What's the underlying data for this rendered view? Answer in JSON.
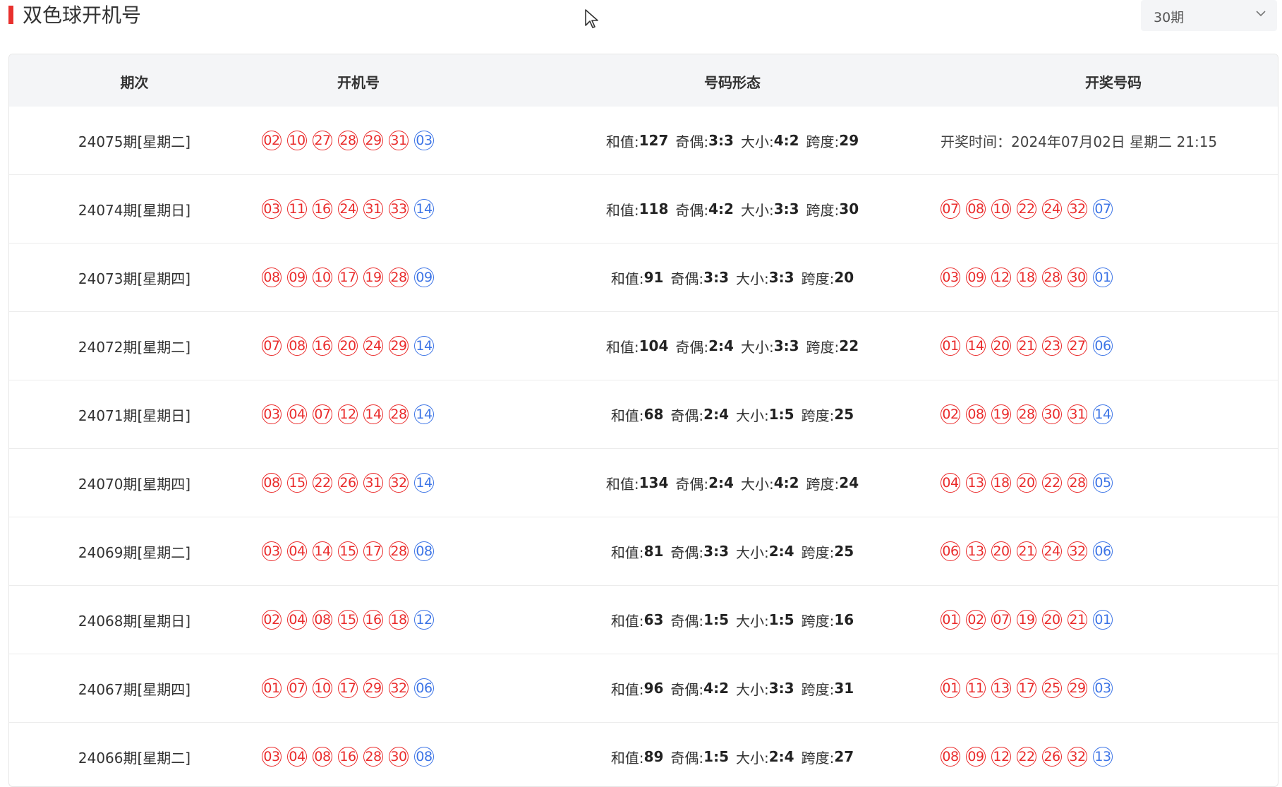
{
  "page": {
    "title": "双色球开机号"
  },
  "period_select": {
    "value": "30期"
  },
  "colors": {
    "red_ball": "#ea2b2b",
    "blue_ball": "#3c74e6",
    "accent": "#e8302d"
  },
  "table": {
    "headers": [
      "期次",
      "开机号",
      "号码形态",
      "开奖号码"
    ],
    "shape_labels": {
      "sum": "和值:",
      "odd_even": "奇偶:",
      "big_small": "大小:",
      "span": "跨度:"
    },
    "rows": [
      {
        "issue": "24075期[星期二]",
        "machine_red": [
          "02",
          "10",
          "27",
          "28",
          "29",
          "31"
        ],
        "machine_blue": "03",
        "sum": "127",
        "odd_even": "3:3",
        "big_small": "4:2",
        "span": "29",
        "draw_time": "开奖时间：2024年07月02日 星期二 21:15",
        "win_red": [],
        "win_blue": ""
      },
      {
        "issue": "24074期[星期日]",
        "machine_red": [
          "03",
          "11",
          "16",
          "24",
          "31",
          "33"
        ],
        "machine_blue": "14",
        "sum": "118",
        "odd_even": "4:2",
        "big_small": "3:3",
        "span": "30",
        "draw_time": "",
        "win_red": [
          "07",
          "08",
          "10",
          "22",
          "24",
          "32"
        ],
        "win_blue": "07"
      },
      {
        "issue": "24073期[星期四]",
        "machine_red": [
          "08",
          "09",
          "10",
          "17",
          "19",
          "28"
        ],
        "machine_blue": "09",
        "sum": "91",
        "odd_even": "3:3",
        "big_small": "3:3",
        "span": "20",
        "draw_time": "",
        "win_red": [
          "03",
          "09",
          "12",
          "18",
          "28",
          "30"
        ],
        "win_blue": "01"
      },
      {
        "issue": "24072期[星期二]",
        "machine_red": [
          "07",
          "08",
          "16",
          "20",
          "24",
          "29"
        ],
        "machine_blue": "14",
        "sum": "104",
        "odd_even": "2:4",
        "big_small": "3:3",
        "span": "22",
        "draw_time": "",
        "win_red": [
          "01",
          "14",
          "20",
          "21",
          "23",
          "27"
        ],
        "win_blue": "06"
      },
      {
        "issue": "24071期[星期日]",
        "machine_red": [
          "03",
          "04",
          "07",
          "12",
          "14",
          "28"
        ],
        "machine_blue": "14",
        "sum": "68",
        "odd_even": "2:4",
        "big_small": "1:5",
        "span": "25",
        "draw_time": "",
        "win_red": [
          "02",
          "08",
          "19",
          "28",
          "30",
          "31"
        ],
        "win_blue": "14"
      },
      {
        "issue": "24070期[星期四]",
        "machine_red": [
          "08",
          "15",
          "22",
          "26",
          "31",
          "32"
        ],
        "machine_blue": "14",
        "sum": "134",
        "odd_even": "2:4",
        "big_small": "4:2",
        "span": "24",
        "draw_time": "",
        "win_red": [
          "04",
          "13",
          "18",
          "20",
          "22",
          "28"
        ],
        "win_blue": "05"
      },
      {
        "issue": "24069期[星期二]",
        "machine_red": [
          "03",
          "04",
          "14",
          "15",
          "17",
          "28"
        ],
        "machine_blue": "08",
        "sum": "81",
        "odd_even": "3:3",
        "big_small": "2:4",
        "span": "25",
        "draw_time": "",
        "win_red": [
          "06",
          "13",
          "20",
          "21",
          "24",
          "32"
        ],
        "win_blue": "06"
      },
      {
        "issue": "24068期[星期日]",
        "machine_red": [
          "02",
          "04",
          "08",
          "15",
          "16",
          "18"
        ],
        "machine_blue": "12",
        "sum": "63",
        "odd_even": "1:5",
        "big_small": "1:5",
        "span": "16",
        "draw_time": "",
        "win_red": [
          "01",
          "02",
          "07",
          "19",
          "20",
          "21"
        ],
        "win_blue": "01"
      },
      {
        "issue": "24067期[星期四]",
        "machine_red": [
          "01",
          "07",
          "10",
          "17",
          "29",
          "32"
        ],
        "machine_blue": "06",
        "sum": "96",
        "odd_even": "4:2",
        "big_small": "3:3",
        "span": "31",
        "draw_time": "",
        "win_red": [
          "01",
          "11",
          "13",
          "17",
          "25",
          "29"
        ],
        "win_blue": "03"
      },
      {
        "issue": "24066期[星期二]",
        "machine_red": [
          "03",
          "04",
          "08",
          "16",
          "28",
          "30"
        ],
        "machine_blue": "08",
        "sum": "89",
        "odd_even": "1:5",
        "big_small": "2:4",
        "span": "27",
        "draw_time": "",
        "win_red": [
          "08",
          "09",
          "12",
          "22",
          "26",
          "32"
        ],
        "win_blue": "13"
      }
    ]
  }
}
